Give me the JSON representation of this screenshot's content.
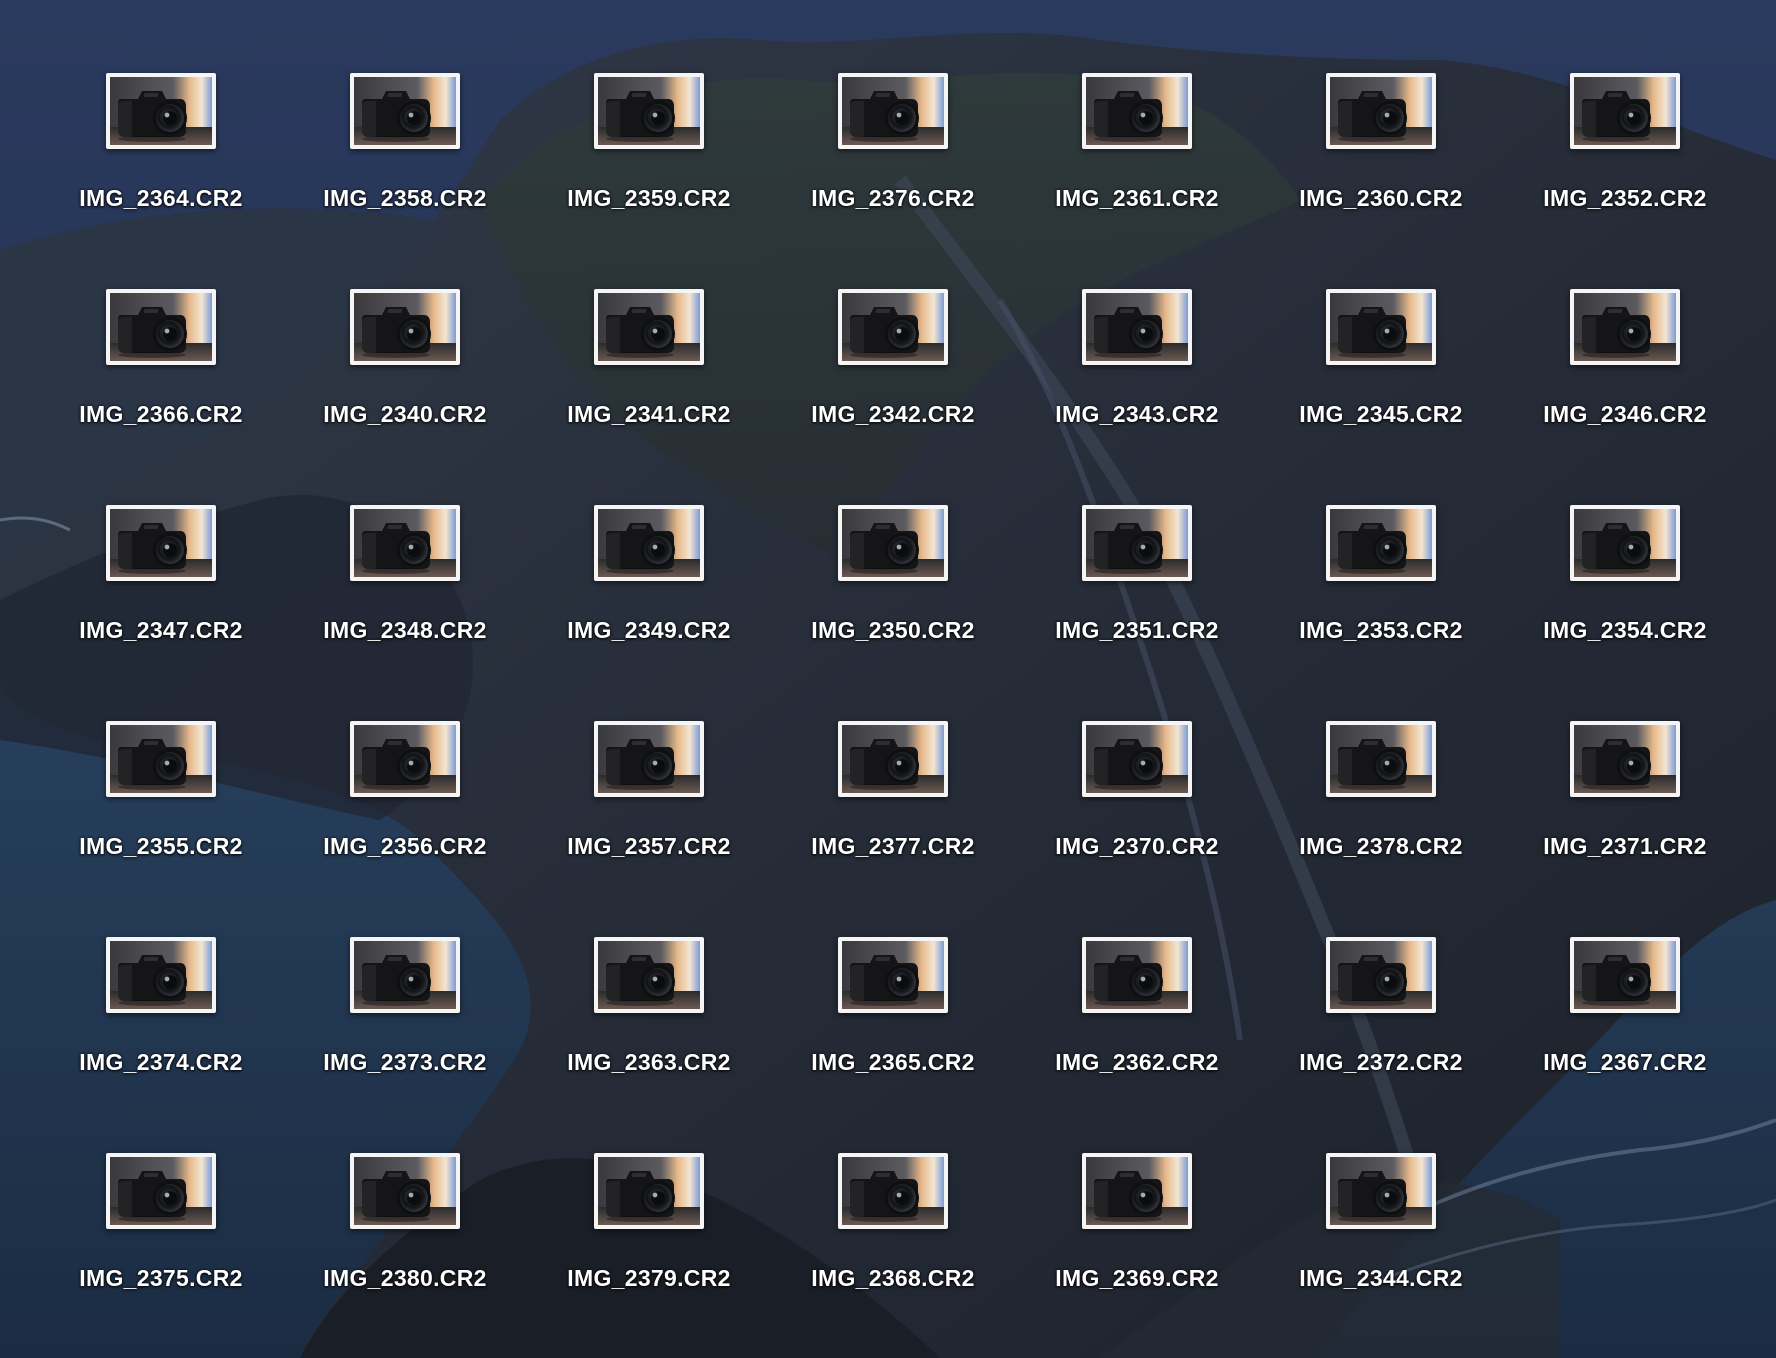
{
  "wallpaper": {
    "name": "Catalina night island",
    "sky_color": "#223152",
    "sea_color": "#1f3550",
    "rock_color": "#262c38"
  },
  "file_icon": {
    "icon": "camera-raw-thumbnail-icon"
  },
  "files": [
    {
      "name": "IMG_2364.CR2"
    },
    {
      "name": "IMG_2358.CR2"
    },
    {
      "name": "IMG_2359.CR2"
    },
    {
      "name": "IMG_2376.CR2"
    },
    {
      "name": "IMG_2361.CR2"
    },
    {
      "name": "IMG_2360.CR2"
    },
    {
      "name": "IMG_2352.CR2"
    },
    {
      "name": "IMG_2366.CR2"
    },
    {
      "name": "IMG_2340.CR2"
    },
    {
      "name": "IMG_2341.CR2"
    },
    {
      "name": "IMG_2342.CR2"
    },
    {
      "name": "IMG_2343.CR2"
    },
    {
      "name": "IMG_2345.CR2"
    },
    {
      "name": "IMG_2346.CR2"
    },
    {
      "name": "IMG_2347.CR2"
    },
    {
      "name": "IMG_2348.CR2"
    },
    {
      "name": "IMG_2349.CR2"
    },
    {
      "name": "IMG_2350.CR2"
    },
    {
      "name": "IMG_2351.CR2"
    },
    {
      "name": "IMG_2353.CR2"
    },
    {
      "name": "IMG_2354.CR2"
    },
    {
      "name": "IMG_2355.CR2"
    },
    {
      "name": "IMG_2356.CR2"
    },
    {
      "name": "IMG_2357.CR2"
    },
    {
      "name": "IMG_2377.CR2"
    },
    {
      "name": "IMG_2370.CR2"
    },
    {
      "name": "IMG_2378.CR2"
    },
    {
      "name": "IMG_2371.CR2"
    },
    {
      "name": "IMG_2374.CR2"
    },
    {
      "name": "IMG_2373.CR2"
    },
    {
      "name": "IMG_2363.CR2"
    },
    {
      "name": "IMG_2365.CR2"
    },
    {
      "name": "IMG_2362.CR2"
    },
    {
      "name": "IMG_2372.CR2"
    },
    {
      "name": "IMG_2367.CR2"
    },
    {
      "name": "IMG_2375.CR2"
    },
    {
      "name": "IMG_2380.CR2"
    },
    {
      "name": "IMG_2379.CR2"
    },
    {
      "name": "IMG_2368.CR2"
    },
    {
      "name": "IMG_2369.CR2"
    },
    {
      "name": "IMG_2344.CR2"
    }
  ]
}
